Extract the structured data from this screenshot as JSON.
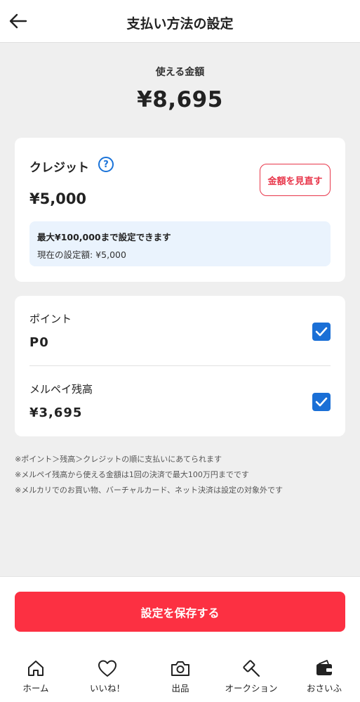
{
  "header": {
    "title": "支払い方法の設定"
  },
  "available": {
    "label": "使える金額",
    "amount": "¥8,695"
  },
  "credit": {
    "label": "クレジット",
    "help_symbol": "?",
    "amount": "¥5,000",
    "review_button": "金額を見直す",
    "info_max": "最大¥100,000まで設定できます",
    "info_current": "現在の設定額: ¥5,000"
  },
  "balances": [
    {
      "label": "ポイント",
      "value": "P0",
      "checked": true
    },
    {
      "label": "メルペイ残高",
      "value": "¥3,695",
      "checked": true
    }
  ],
  "notes": [
    "※ポイント＞残高＞クレジットの順に支払いにあてられます",
    "※メルペイ残高から使える金額は1回の決済で最大100万円までです",
    "※メルカリでのお買い物、バーチャルカード、ネット決済は設定の対象外です"
  ],
  "save_button": "設定を保存する",
  "nav": [
    {
      "label": "ホーム",
      "icon": "home-icon"
    },
    {
      "label": "いいね！",
      "icon": "heart-icon"
    },
    {
      "label": "出品",
      "icon": "camera-icon"
    },
    {
      "label": "オークション",
      "icon": "gavel-icon"
    },
    {
      "label": "おさいふ",
      "icon": "wallet-icon"
    }
  ],
  "colors": {
    "accent": "#fc3042",
    "checkbox": "#1a6fd6",
    "info_bg": "#eaf3fd",
    "review": "#e8364a"
  }
}
